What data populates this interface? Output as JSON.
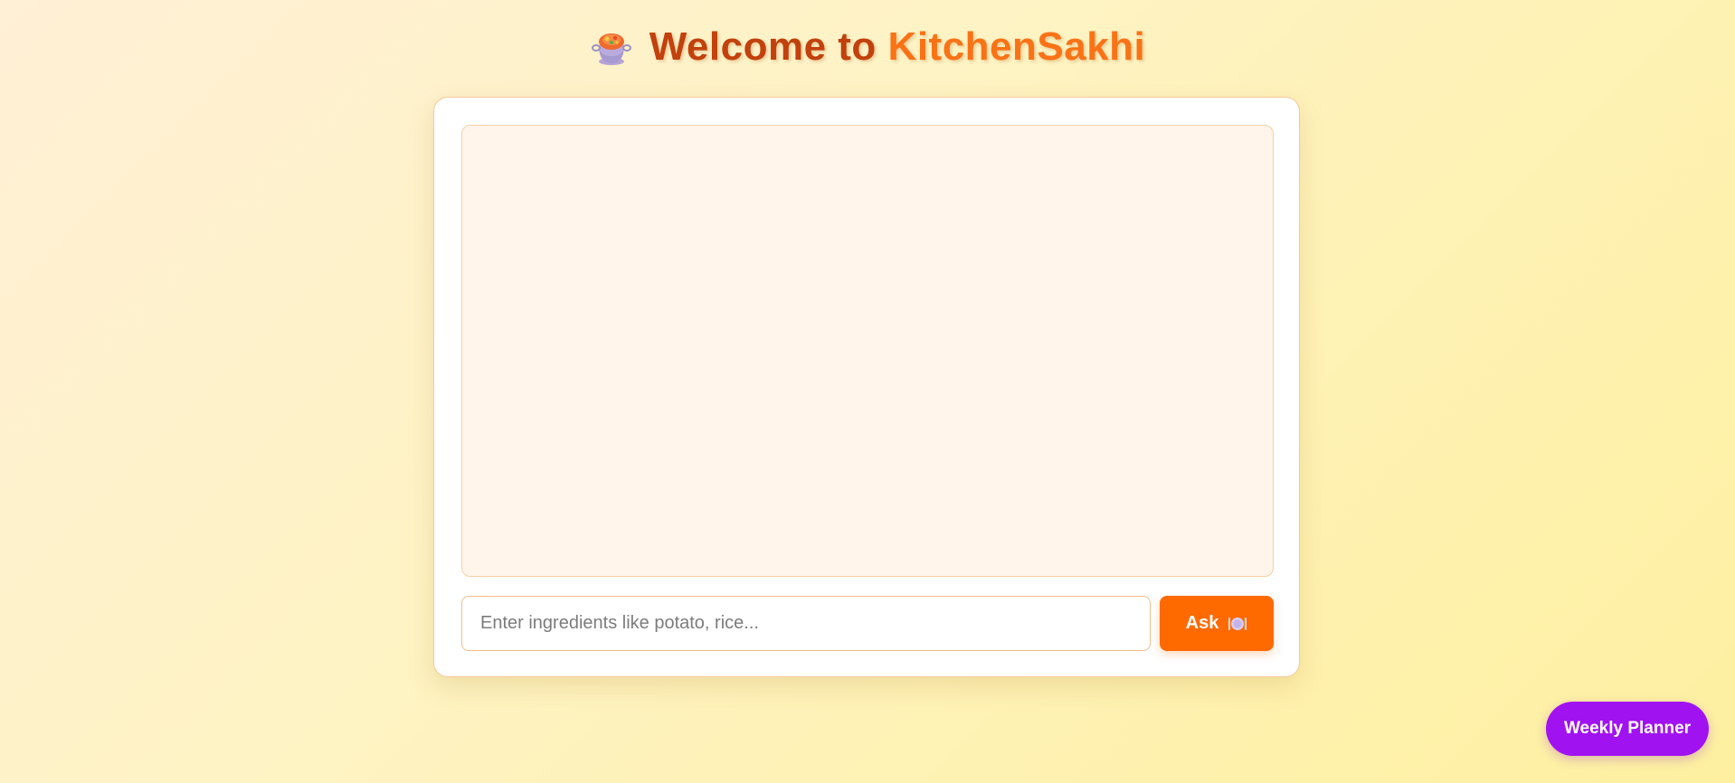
{
  "header": {
    "icon": "cooking-pot-icon",
    "title_prefix": "Welcome to ",
    "title_brand": "KitchenSakhi"
  },
  "chat": {
    "messages": []
  },
  "input": {
    "value": "",
    "placeholder": "Enter ingredients like potato, rice..."
  },
  "ask_button": {
    "label": "Ask",
    "icon": "plate-icon"
  },
  "planner_button": {
    "label": "Weekly Planner"
  },
  "colors": {
    "title_dark": "#c2410c",
    "title_brand": "#f97316",
    "ask_button": "#ff6a00",
    "planner_button": "#a112f0"
  }
}
